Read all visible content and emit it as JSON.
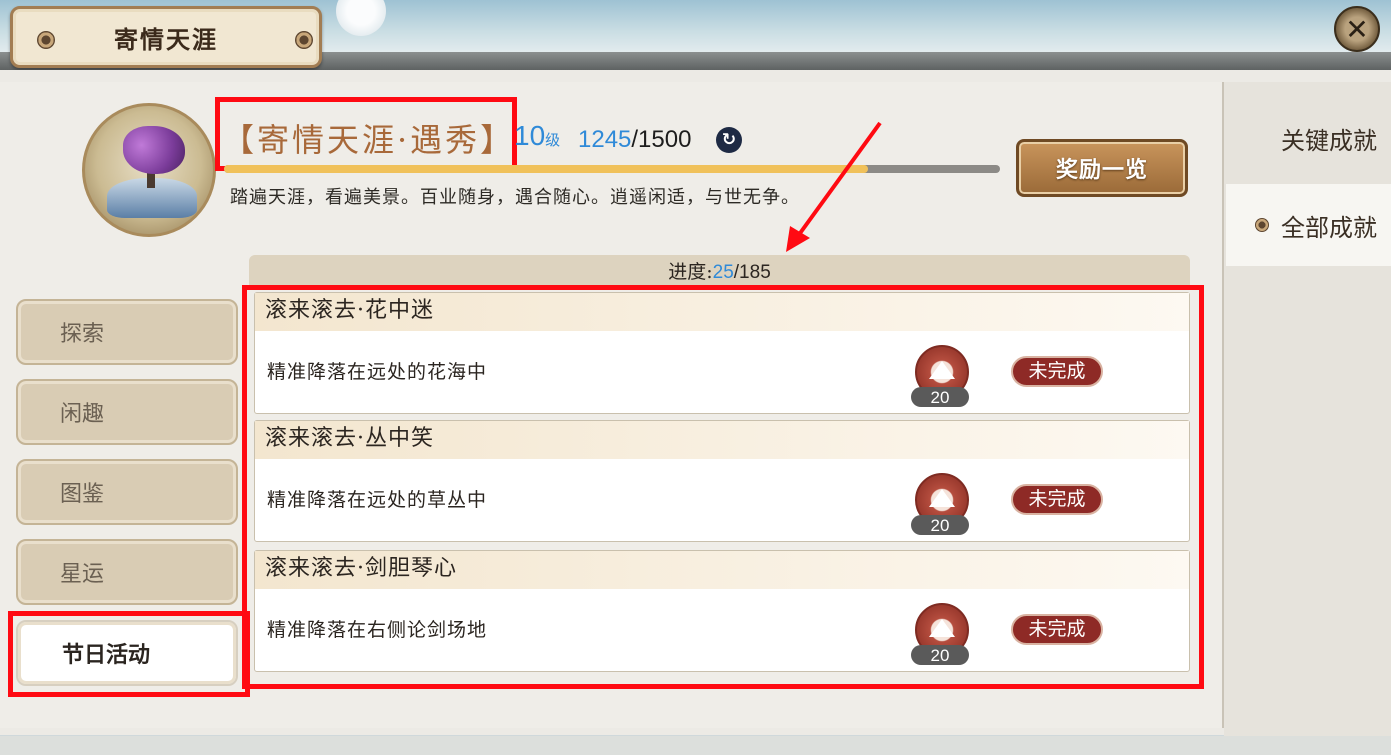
{
  "window": {
    "title": "寄情天涯",
    "close_label": "✕"
  },
  "achievement": {
    "title": "【寄情天涯·遇秀】",
    "level": "10",
    "level_unit": "级",
    "exp_current": "1245",
    "exp_max": "/1500",
    "exp_progress": 0.83,
    "description": "踏遍天涯，看遍美景。百业随身，遇合随心。逍遥闲适，与世无争。",
    "reward_button": "奖励一览"
  },
  "right_tabs": [
    {
      "label": "关键成就"
    },
    {
      "label": "全部成就"
    }
  ],
  "left_tabs": [
    {
      "label": "探索"
    },
    {
      "label": "闲趣"
    },
    {
      "label": "图鉴"
    },
    {
      "label": "星运"
    },
    {
      "label": "节日活动"
    }
  ],
  "progress": {
    "label": "进度:",
    "current": "25",
    "total": "/185"
  },
  "items": [
    {
      "title": "滚来滚去·花中迷",
      "desc": "精准降落在远处的花海中",
      "points": "20",
      "status": "未完成"
    },
    {
      "title": "滚来滚去·丛中笑",
      "desc": "精准降落在远处的草丛中",
      "points": "20",
      "status": "未完成"
    },
    {
      "title": "滚来滚去·剑胆琴心",
      "desc": "精准降落在右侧论剑场地",
      "points": "20",
      "status": "未完成"
    }
  ],
  "colors": {
    "highlight": "#ff0a12",
    "accent_blue": "#2f8ad8",
    "status_red": "#8e2a26"
  }
}
